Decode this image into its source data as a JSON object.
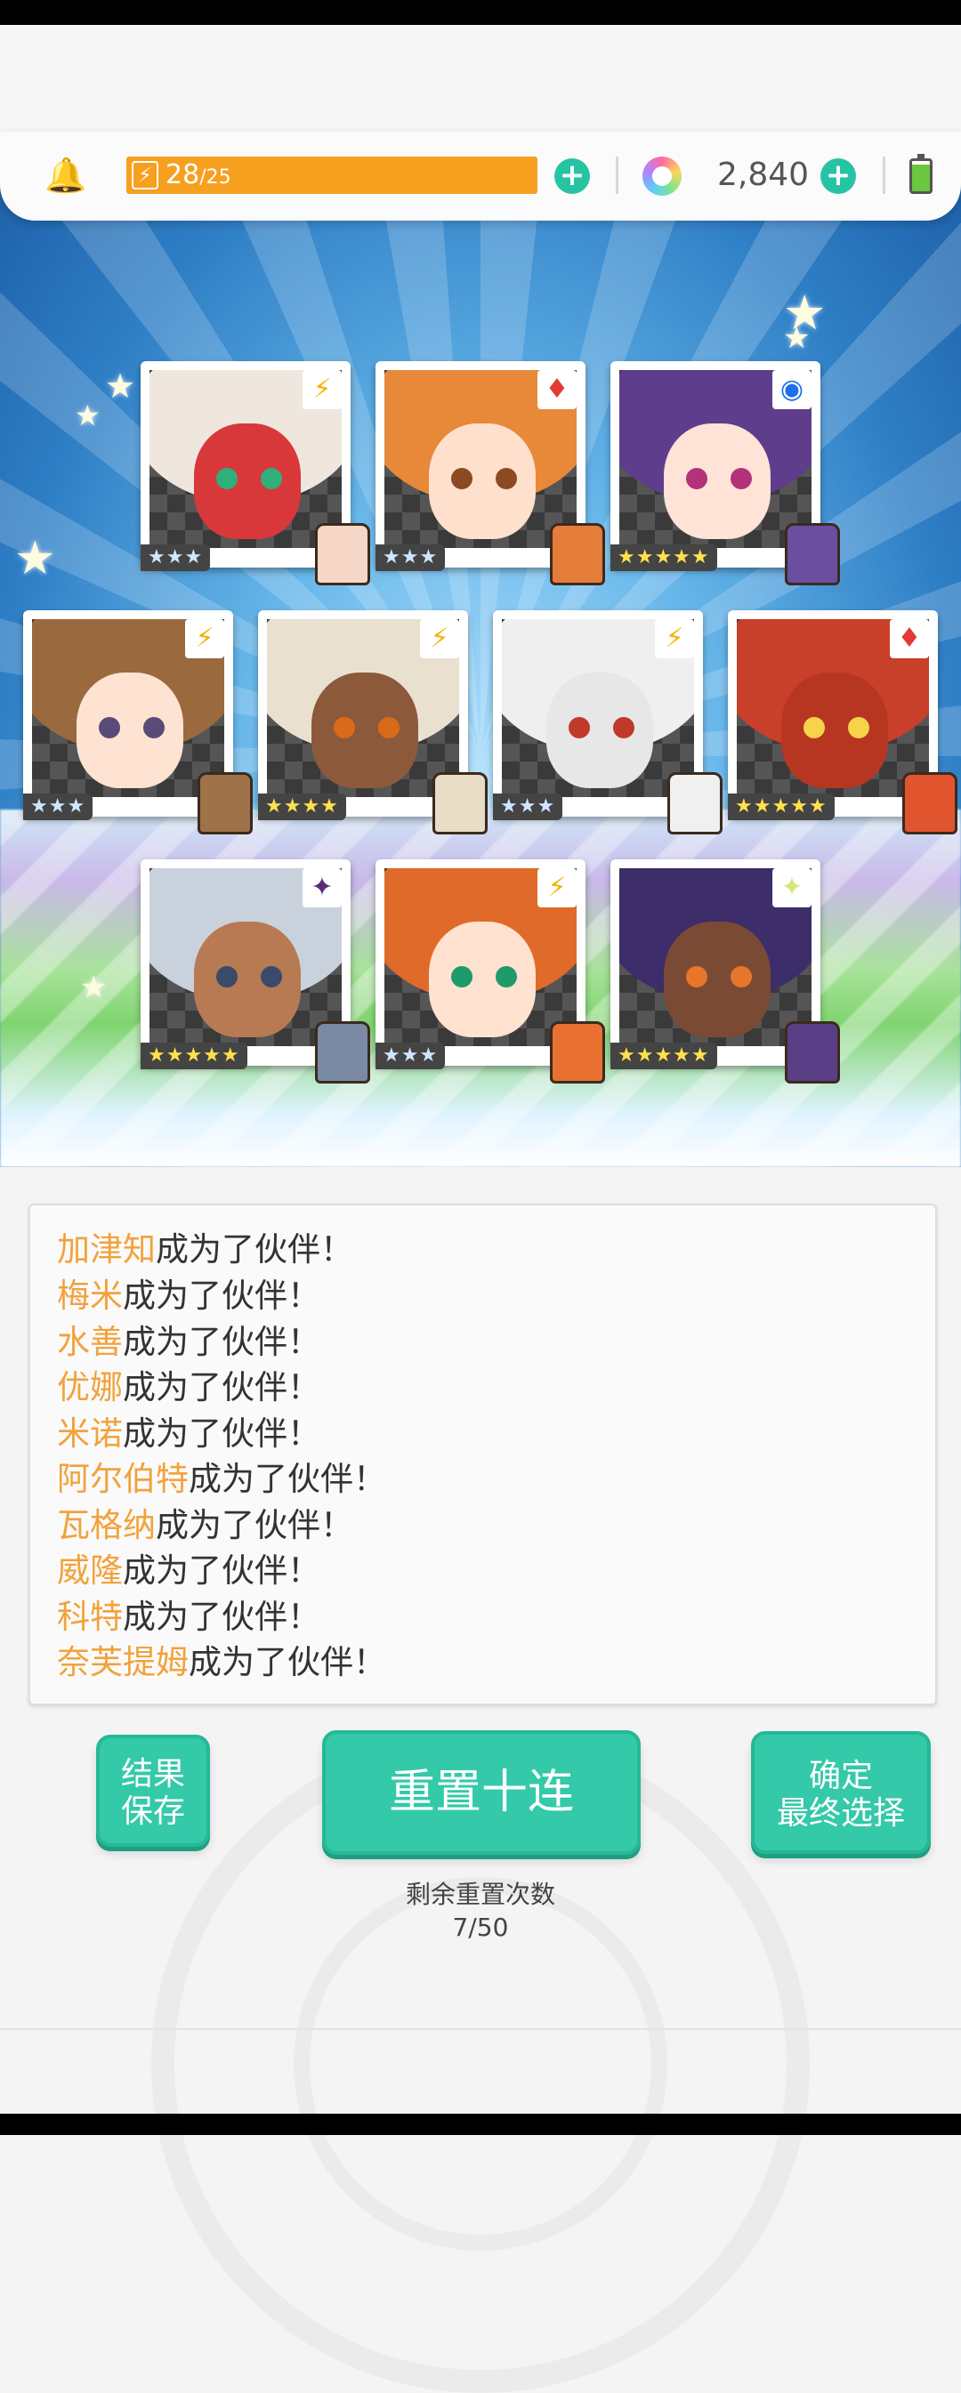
{
  "header": {
    "energy_current": "28",
    "energy_max": "/25",
    "gem_count": "2,840",
    "icons": [
      "bell-icon",
      "lightning-icon",
      "plus-icon",
      "gem-icon",
      "battery-icon"
    ]
  },
  "cards": [
    {
      "stars": "★★★",
      "element": "thunder",
      "element_glyph": "⚡",
      "hair": "#efe7dd",
      "skin": "#d8383a",
      "eye": "#2fb07a",
      "sprite": "#f6d6c6"
    },
    {
      "stars": "★★★",
      "element": "fire",
      "element_glyph": "♦",
      "hair": "#e8893a",
      "skin": "#ffe0cc",
      "eye": "#8b4a22",
      "sprite": "#e57d3a"
    },
    {
      "stars": "★★★★★",
      "element": "water",
      "element_glyph": "◉",
      "hair": "#5d3d8c",
      "skin": "#ffe3d6",
      "eye": "#b3327a",
      "sprite": "#6a4fa0"
    },
    {
      "stars": "★★★",
      "element": "thunder",
      "element_glyph": "⚡",
      "hair": "#9a6a3e",
      "skin": "#ffe3d2",
      "eye": "#5a4a78",
      "sprite": "#a0724a"
    },
    {
      "stars": "★★★★",
      "element": "thunder",
      "element_glyph": "⚡",
      "hair": "#eae0cf",
      "skin": "#8c5a3a",
      "eye": "#d96a1a",
      "sprite": "#e8dcc6"
    },
    {
      "stars": "★★★",
      "element": "thunder",
      "element_glyph": "⚡",
      "hair": "#efefef",
      "skin": "#e7e7e7",
      "eye": "#c0392b",
      "sprite": "#f0f0f0"
    },
    {
      "stars": "★★★★★",
      "element": "fire",
      "element_glyph": "♦",
      "hair": "#c8402a",
      "skin": "#b73622",
      "eye": "#f6d34a",
      "sprite": "#e0552e"
    },
    {
      "stars": "★★★★★",
      "element": "dark",
      "element_glyph": "✦",
      "hair": "#c9d2dc",
      "skin": "#b87a52",
      "eye": "#3a4a6a",
      "sprite": "#7b8aa4"
    },
    {
      "stars": "★★★",
      "element": "thunder",
      "element_glyph": "⚡",
      "hair": "#e06a2a",
      "skin": "#ffe2cf",
      "eye": "#1f9a6a",
      "sprite": "#e87030"
    },
    {
      "stars": "★★★★★",
      "element": "light",
      "element_glyph": "✦",
      "hair": "#3d2d6a",
      "skin": "#7a4a34",
      "eye": "#e8762a",
      "sprite": "#5a3e86"
    }
  ],
  "log": [
    {
      "name": "加津知",
      "suffix": "成为了伙伴！"
    },
    {
      "name": "梅米",
      "suffix": "成为了伙伴！"
    },
    {
      "name": "水善",
      "suffix": "成为了伙伴！"
    },
    {
      "name": "优娜",
      "suffix": "成为了伙伴！"
    },
    {
      "name": "米诺",
      "suffix": "成为了伙伴！"
    },
    {
      "name": "阿尔伯特",
      "suffix": "成为了伙伴！"
    },
    {
      "name": "瓦格纳",
      "suffix": "成为了伙伴！"
    },
    {
      "name": "威隆",
      "suffix": "成为了伙伴！"
    },
    {
      "name": "科特",
      "suffix": "成为了伙伴！"
    },
    {
      "name": "奈芙提姆",
      "suffix": "成为了伙伴！"
    }
  ],
  "buttons": {
    "save_line1": "结果",
    "save_line2": "保存",
    "reset": "重置十连",
    "confirm_line1": "确定",
    "confirm_line2": "最终选择"
  },
  "remaining": {
    "label": "剩余重置次数",
    "count": "7/50"
  },
  "colors": {
    "accent_teal": "#34c9a8",
    "energy_orange": "#f7a020",
    "name_orange": "#f2a23b"
  }
}
